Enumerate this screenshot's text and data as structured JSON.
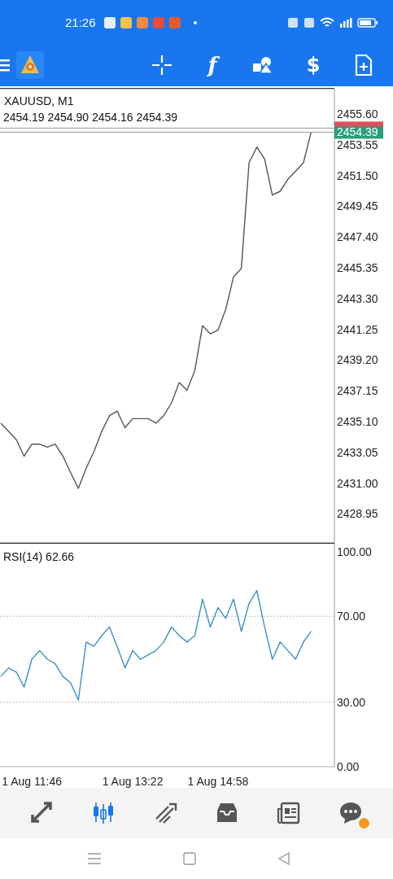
{
  "status_bar": {
    "time": "21:26",
    "notification_icons": [
      {
        "color": "#e8f0ff"
      },
      {
        "color": "#f3c24a"
      },
      {
        "color": "#f08a3c"
      },
      {
        "color": "#e84a3c"
      },
      {
        "color": "#e85a2a"
      }
    ]
  },
  "toolbar": {
    "tools": [
      {
        "kind": "crosshair"
      },
      {
        "kind": "function",
        "glyph": "f"
      },
      {
        "kind": "objects"
      },
      {
        "kind": "trade",
        "glyph": "$"
      },
      {
        "kind": "new-order"
      }
    ]
  },
  "price_panel": {
    "symbol": "XAUUSD, M1",
    "quote": "2454.19 2454.90 2454.16 2454.39",
    "ask_line": true,
    "bid_label": "2454.39",
    "chart_data": {
      "type": "line",
      "categories": [
        null,
        null,
        null,
        null,
        null,
        null,
        null,
        null,
        null,
        null,
        null,
        null,
        null,
        null,
        null,
        null,
        null,
        null,
        null,
        null,
        null,
        null,
        null,
        null,
        null,
        null,
        null,
        null,
        null,
        null,
        null,
        null,
        null,
        null,
        null,
        null,
        null,
        null,
        null,
        null,
        null,
        null,
        null,
        null
      ],
      "series": [
        {
          "color": "#555555",
          "values": [
            2435.0,
            2434.45,
            2433.9,
            2432.8,
            2433.6,
            2433.6,
            2433.4,
            2433.6,
            2432.8,
            2431.7,
            2430.65,
            2432.0,
            2433.1,
            2434.45,
            2435.5,
            2435.8,
            2434.7,
            2435.3,
            2435.3,
            2435.3,
            2435.0,
            2435.5,
            2436.35,
            2437.7,
            2437.2,
            2438.5,
            2441.5,
            2440.95,
            2441.2,
            2442.6,
            2444.75,
            2445.3,
            2452.35,
            2453.4,
            2452.6,
            2450.2,
            2450.45,
            2451.25,
            2451.8,
            2452.35,
            2454.39,
            null,
            null,
            null
          ]
        }
      ],
      "ylim": [
        2426.97,
        2457.34
      ],
      "yticks": [
        {
          "value": 2455.6,
          "label": "2455.60"
        },
        {
          "value": 2453.55,
          "label": "2453.55"
        },
        {
          "value": 2451.5,
          "label": "2451.50"
        },
        {
          "value": 2449.45,
          "label": "2449.45"
        },
        {
          "value": 2447.4,
          "label": "2447.40"
        },
        {
          "value": 2445.35,
          "label": "2445.35"
        },
        {
          "value": 2443.3,
          "label": "2443.30"
        },
        {
          "value": 2441.25,
          "label": "2441.25"
        },
        {
          "value": 2439.2,
          "label": "2439.20"
        },
        {
          "value": 2437.15,
          "label": "2437.15"
        },
        {
          "value": 2435.1,
          "label": "2435.10"
        },
        {
          "value": 2433.05,
          "label": "2433.05"
        },
        {
          "value": 2431.0,
          "label": "2431.00"
        },
        {
          "value": 2428.95,
          "label": "2428.95"
        }
      ]
    }
  },
  "rsi_panel": {
    "label": "RSI(14) 62.66",
    "chart_data": {
      "type": "line",
      "categories": [
        null,
        null,
        null,
        null,
        "1 Aug 11:46",
        null,
        null,
        null,
        null,
        null,
        null,
        null,
        null,
        null,
        null,
        null,
        null,
        "1 Aug 13:22",
        null,
        null,
        null,
        null,
        null,
        null,
        null,
        null,
        null,
        null,
        "1 Aug 14:58",
        null,
        null,
        null,
        null,
        null,
        null,
        null,
        null,
        null,
        null,
        null,
        null,
        null,
        null,
        null
      ],
      "series": [
        {
          "color": "#3a8fc8",
          "values": [
            42,
            46,
            44,
            37,
            50,
            54,
            50,
            48,
            42,
            39,
            31,
            58,
            56,
            61,
            65,
            56,
            46,
            54,
            50,
            52,
            54,
            58,
            65,
            61,
            58,
            61,
            78,
            65,
            74,
            69,
            78,
            63,
            76,
            82,
            65,
            50,
            58,
            54,
            50,
            58,
            63,
            null,
            null,
            null
          ]
        }
      ],
      "ylim": [
        0,
        100
      ],
      "yticks": [
        {
          "value": 100,
          "label": "100.00"
        },
        {
          "value": 70,
          "label": "70.00"
        },
        {
          "value": 30,
          "label": "30.00"
        },
        {
          "value": 0,
          "label": "0.00"
        }
      ]
    }
  },
  "bottom_nav": [
    {
      "kind": "quotes",
      "selected": false
    },
    {
      "kind": "chart",
      "selected": true
    },
    {
      "kind": "trade",
      "selected": false
    },
    {
      "kind": "history",
      "selected": false
    },
    {
      "kind": "news",
      "selected": false
    },
    {
      "kind": "chat",
      "selected": false,
      "badge": true
    }
  ]
}
